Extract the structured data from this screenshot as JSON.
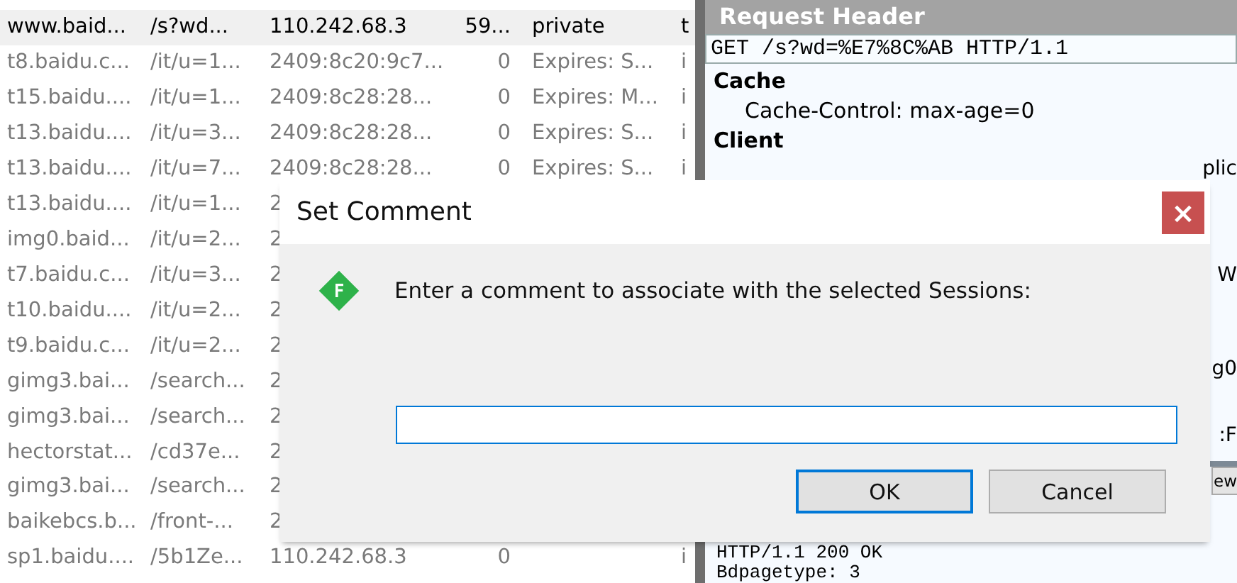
{
  "sessions": {
    "rows": [
      {
        "host": "www.baid...",
        "url": "/s?wd...",
        "ip": "110.242.68.3",
        "body": "59...",
        "caching": "private",
        "content_type": "t",
        "selected": true
      },
      {
        "host": "t8.baidu.c...",
        "url": "/it/u=1...",
        "ip": "2409:8c20:9c7...",
        "body": "0",
        "caching": "Expires: S...",
        "content_type": "i",
        "selected": false
      },
      {
        "host": "t15.baidu....",
        "url": "/it/u=1...",
        "ip": "2409:8c28:28...",
        "body": "0",
        "caching": "Expires: M...",
        "content_type": "i",
        "selected": false
      },
      {
        "host": "t13.baidu....",
        "url": "/it/u=3...",
        "ip": "2409:8c28:28...",
        "body": "0",
        "caching": "Expires: S...",
        "content_type": "i",
        "selected": false
      },
      {
        "host": "t13.baidu....",
        "url": "/it/u=7...",
        "ip": "2409:8c28:28...",
        "body": "0",
        "caching": "Expires: S...",
        "content_type": "i",
        "selected": false
      },
      {
        "host": "t13.baidu....",
        "url": "/it/u=1...",
        "ip": "2",
        "selected": false
      },
      {
        "host": "img0.baid...",
        "url": "/it/u=2...",
        "ip": "2",
        "selected": false
      },
      {
        "host": "t7.baidu.c...",
        "url": "/it/u=3...",
        "ip": "2",
        "selected": false
      },
      {
        "host": "t10.baidu....",
        "url": "/it/u=2...",
        "ip": "2",
        "selected": false
      },
      {
        "host": "t9.baidu.c...",
        "url": "/it/u=2...",
        "ip": "2",
        "selected": false
      },
      {
        "host": "gimg3.bai...",
        "url": "/search...",
        "ip": "2",
        "selected": false
      },
      {
        "host": "gimg3.bai...",
        "url": "/search...",
        "ip": "2",
        "selected": false
      },
      {
        "host": "hectorstat...",
        "url": "/cd37e...",
        "ip": "2",
        "selected": false
      },
      {
        "host": "gimg3.bai...",
        "url": "/search...",
        "ip": "2",
        "selected": false
      },
      {
        "host": "baikebcs.b...",
        "url": "/front-...",
        "ip": "2",
        "selected": false
      },
      {
        "host": "sp1.baidu....",
        "url": "/5b1Ze...",
        "ip": "110.242.68.3",
        "body": "0",
        "content_type": "i",
        "selected": false
      }
    ]
  },
  "inspector": {
    "title": "Request Header",
    "request_line": "GET /s?wd=%E7%8C%AB HTTP/1.1",
    "groups": [
      {
        "name": "Cache",
        "headers": [
          "Cache-Control: max-age=0"
        ]
      },
      {
        "name": "Client"
      }
    ],
    "fragments": [
      "plic",
      "W",
      "g0",
      ":F"
    ],
    "tab_fragment": "ew",
    "response_lines": [
      "HTTP/1.1 200 OK",
      "Bdpagetype: 3"
    ]
  },
  "dialog": {
    "title": "Set Comment",
    "close": "×",
    "message": "Enter a comment to associate with the selected Sessions:",
    "buttons": [
      {
        "label": "OK",
        "default": true
      },
      {
        "label": "Cancel",
        "default": false
      }
    ]
  }
}
